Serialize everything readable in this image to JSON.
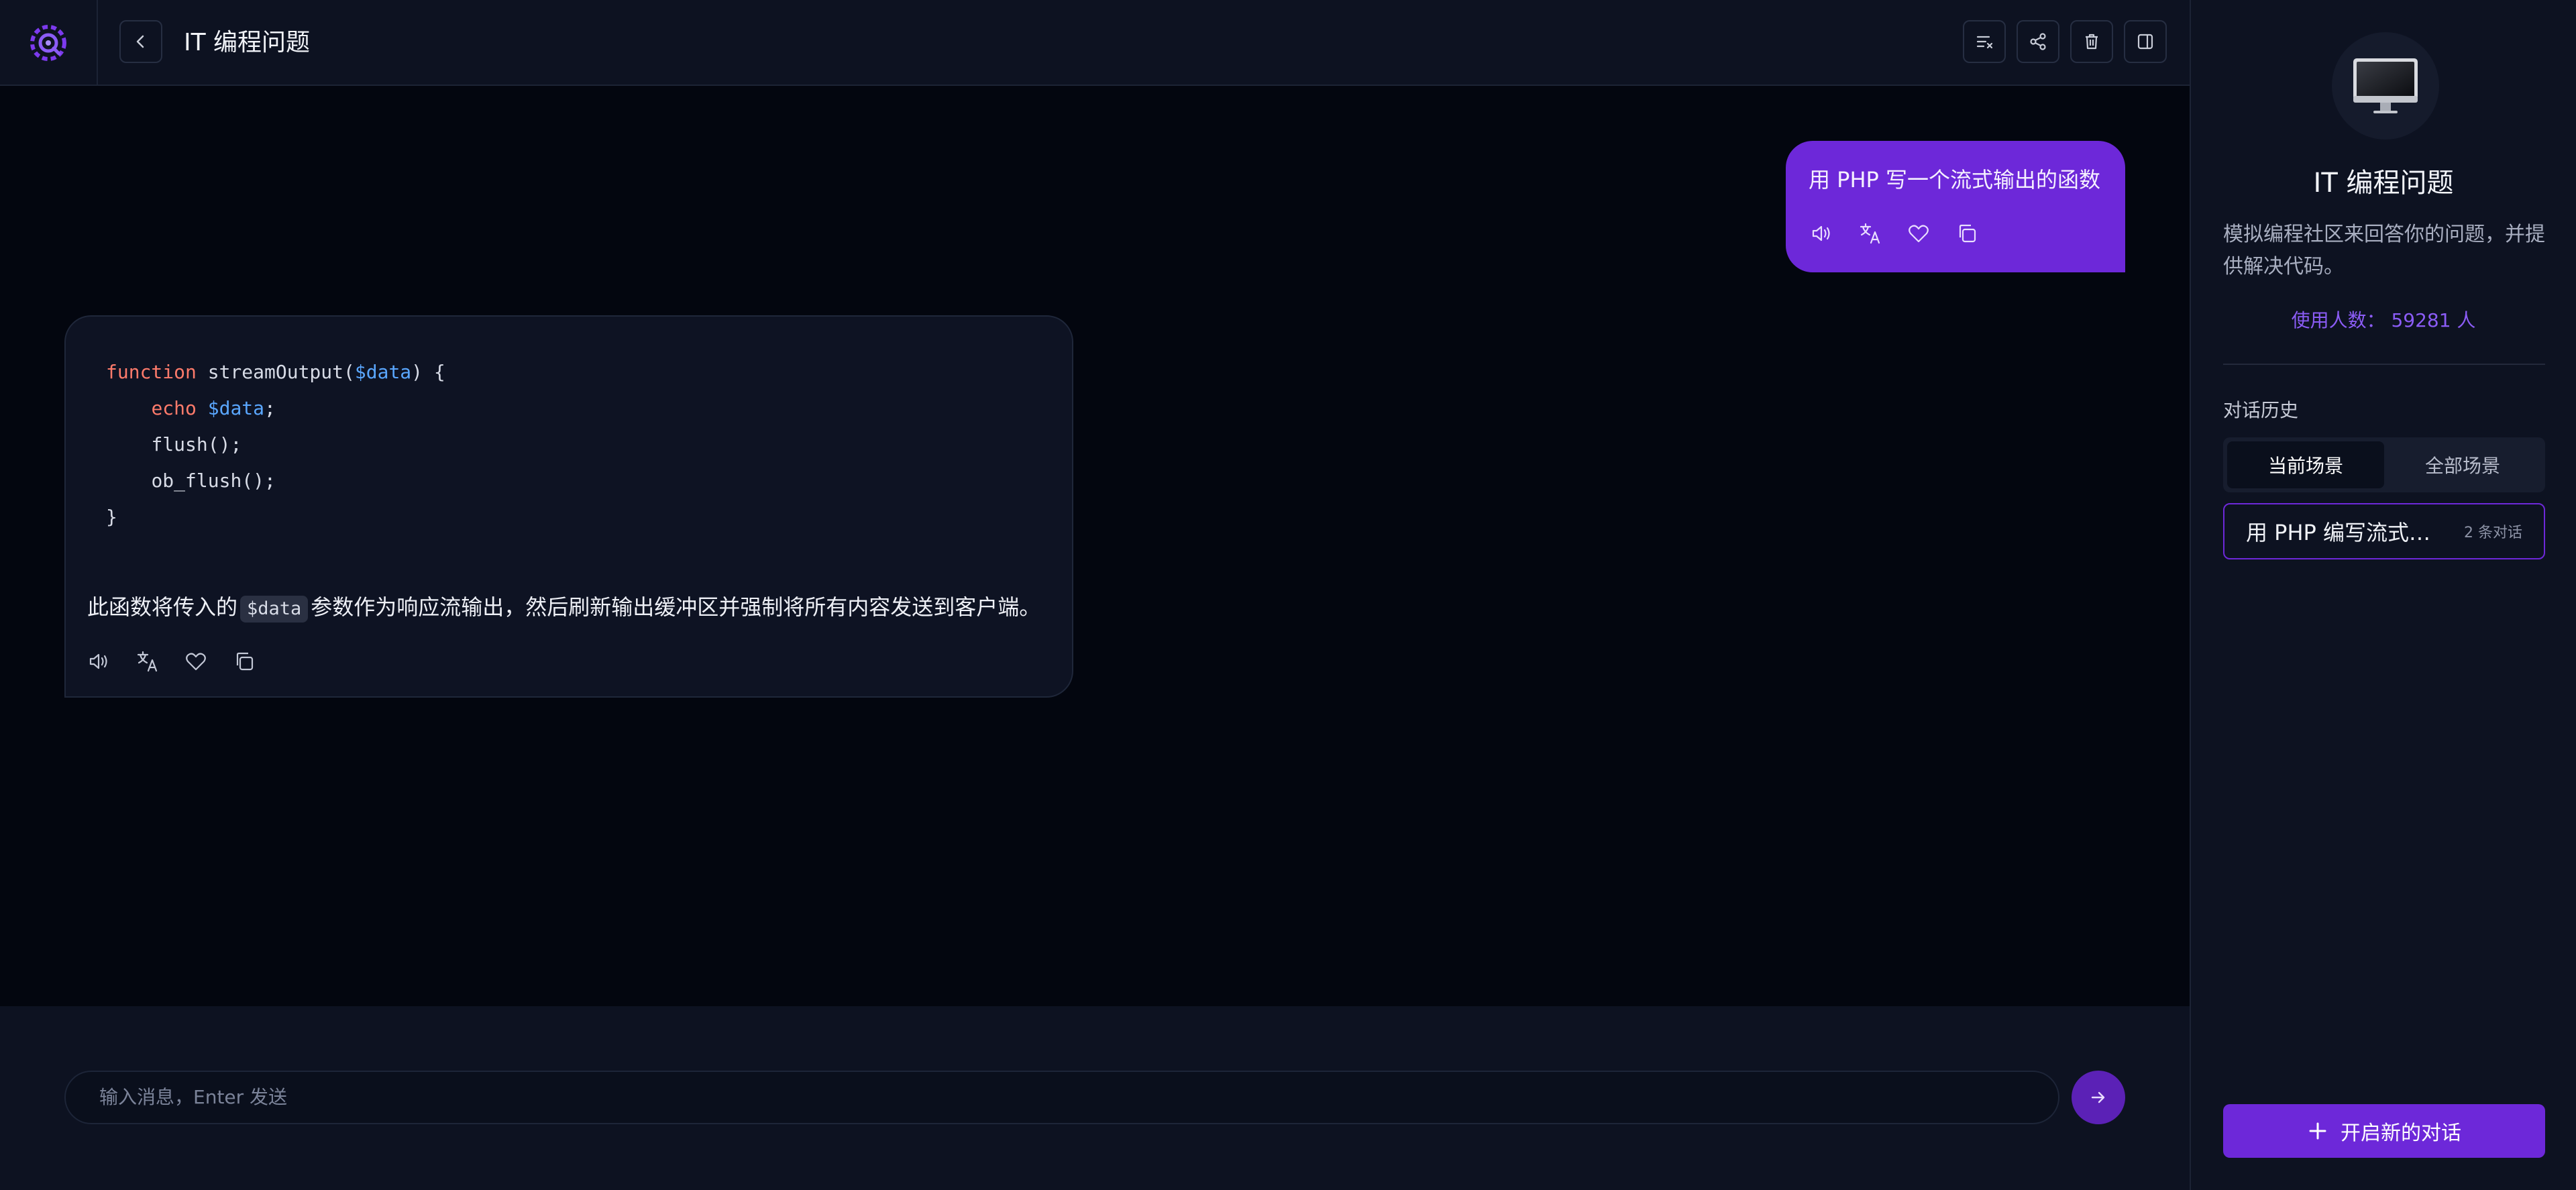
{
  "header": {
    "title": "IT 编程问题",
    "actions": [
      "clear-icon",
      "share-icon",
      "trash-icon",
      "panel-icon"
    ]
  },
  "messages": {
    "user": {
      "text": "用 PHP 写一个流式输出的函数"
    },
    "bot": {
      "code": {
        "line1_kw": "function",
        "line1_name": " streamOutput(",
        "line1_var": "$data",
        "line1_end": ") {",
        "line2_kw": "echo",
        "line2_var": "$data",
        "line2_end": ";",
        "line3": "flush();",
        "line4": "ob_flush();",
        "line5": "}"
      },
      "text_before": "此函数将传入的",
      "inline_code": "$data",
      "text_after": "参数作为响应流输出，然后刷新输出缓冲区并强制将所有内容发送到客户端。"
    }
  },
  "message_actions": [
    "speaker-icon",
    "translate-icon",
    "heart-icon",
    "copy-icon"
  ],
  "input": {
    "placeholder": "输入消息，Enter 发送"
  },
  "sidebar": {
    "title": "IT 编程问题",
    "description": "模拟编程社区来回答你的问题，并提供解决代码。",
    "users": "使用人数： 59281 人",
    "history_label": "对话历史",
    "tabs": [
      {
        "label": "当前场景",
        "active": true
      },
      {
        "label": "全部场景",
        "active": false
      }
    ],
    "conversations": [
      {
        "title": "用 PHP 编写流式输出函数",
        "count": "2 条对话"
      }
    ],
    "new_chat_label": "开启新的对话"
  },
  "colors": {
    "accent": "#6d28d9",
    "background": "#03060f",
    "panel": "#0d1221"
  }
}
